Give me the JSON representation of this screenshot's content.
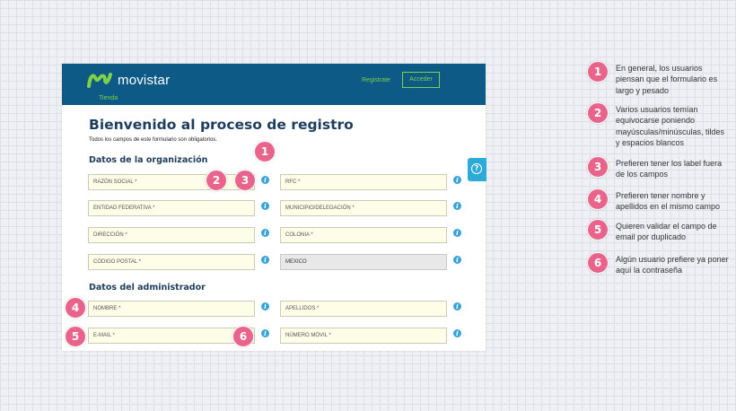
{
  "header": {
    "brand": "movistar",
    "nav_link": "Tienda",
    "register_link": "Registrate",
    "login_button": "Acceder"
  },
  "form": {
    "title": "Bienvenido al proceso de registro",
    "subtitle": "Todos los campos de este formulario son obligatorios.",
    "org_section": "Datos de la organización",
    "admin_section": "Datos del administrador",
    "fields": {
      "razon_social": "RAZÓN SOCIAL *",
      "rfc": "RFC *",
      "entidad": "ENTIDAD FEDERATIVA *",
      "municipio": "MUNICIPIO/DELEGACIÓN *",
      "direccion": "DIRECCIÓN *",
      "colonia": "COLONIA *",
      "codigo_postal": "CÓDIGO POSTAL *",
      "pais": "MEXICO",
      "nombre": "NOMBRE *",
      "apellidos": "APELLIDOS *",
      "email": "E-MAIL *",
      "movil": "NÚMERO MÓVIL *"
    },
    "info_glyph": "i",
    "help_glyph": "?"
  },
  "badges": [
    "1",
    "2",
    "3",
    "4",
    "5",
    "6"
  ],
  "notes": [
    {
      "num": "1",
      "text": "En general, los usuarios piensan que el formulario es largo y pesado"
    },
    {
      "num": "2",
      "text": "Varios usuarios temían equivocarse poniendo mayúsculas/minúsculas, tildes y espacios blancos"
    },
    {
      "num": "3",
      "text": "Prefieren tener los label fuera de los campos"
    },
    {
      "num": "4",
      "text": "Prefieren tener nombre y apellidos en el mismo campo"
    },
    {
      "num": "5",
      "text": "Quieren validar el campo de email por duplicado"
    },
    {
      "num": "6",
      "text": "Algún usuario prefiere ya poner aquí la contraseña"
    }
  ],
  "colors": {
    "header": "#0c5a85",
    "accent_green": "#7fd14a",
    "title": "#1e3d5c",
    "badge": "#e9648c",
    "info": "#3aa3d6",
    "field_bg": "#fdfde8"
  },
  "icons": [
    "movistar-logo-icon",
    "info-icon",
    "help-icon"
  ]
}
